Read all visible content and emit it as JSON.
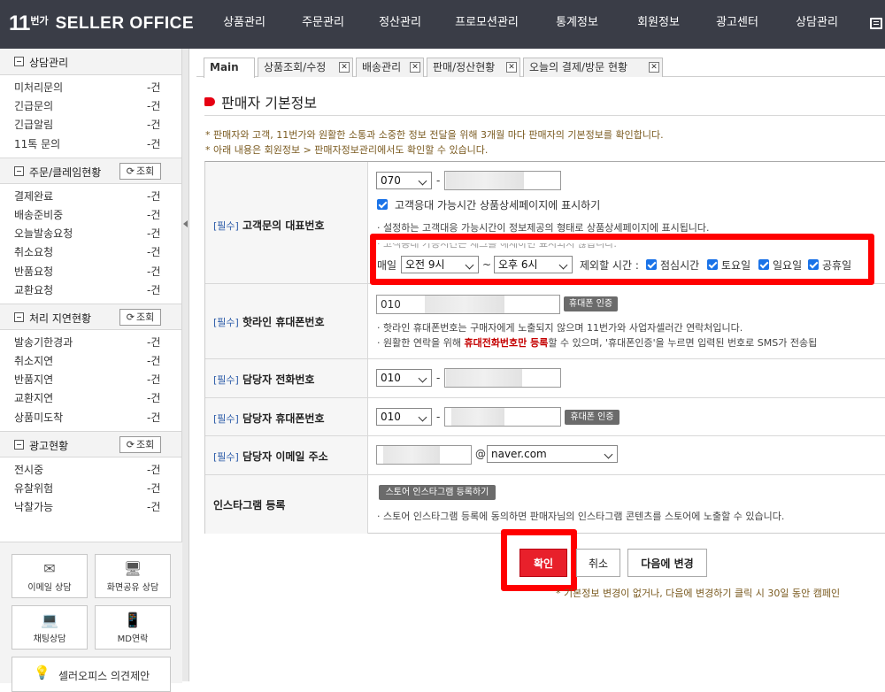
{
  "header": {
    "logo_11": "11",
    "logo_bunga": "번가",
    "logo_seller": "SELLER OFFICE",
    "nav": [
      "상품관리",
      "주문관리",
      "정산관리",
      "프로모션관리",
      "통계정보",
      "회원정보",
      "광고센터",
      "상담관리"
    ],
    "menu_icon": "menu-icon"
  },
  "sidebar": {
    "sections": [
      {
        "title": "상담관리",
        "refresh": "",
        "items": [
          {
            "label": "미처리문의",
            "count": "-건"
          },
          {
            "label": "긴급문의",
            "count": "-건"
          },
          {
            "label": "긴급알림",
            "count": "-건"
          },
          {
            "label": "11톡 문의",
            "count": "-건"
          }
        ]
      },
      {
        "title": "주문/클레임현황",
        "refresh": "조회",
        "items": [
          {
            "label": "결제완료",
            "count": "-건"
          },
          {
            "label": "배송준비중",
            "count": "-건"
          },
          {
            "label": "오늘발송요청",
            "count": "-건"
          },
          {
            "label": "취소요청",
            "count": "-건"
          },
          {
            "label": "반품요청",
            "count": "-건"
          },
          {
            "label": "교환요청",
            "count": "-건"
          }
        ]
      },
      {
        "title": "처리 지연현황",
        "refresh": "조회",
        "items": [
          {
            "label": "발송기한경과",
            "count": "-건"
          },
          {
            "label": "취소지연",
            "count": "-건"
          },
          {
            "label": "반품지연",
            "count": "-건"
          },
          {
            "label": "교환지연",
            "count": "-건"
          },
          {
            "label": "상품미도착",
            "count": "-건"
          }
        ]
      },
      {
        "title": "광고현황",
        "refresh": "조회",
        "items": [
          {
            "label": "전시중",
            "count": "-건"
          },
          {
            "label": "유찰위험",
            "count": "-건"
          },
          {
            "label": "낙찰가능",
            "count": "-건"
          }
        ]
      }
    ],
    "buttons": [
      {
        "label": "이메일 상담",
        "icon": "envelope-icon"
      },
      {
        "label": "화면공유 상담",
        "icon": "screen-share-icon"
      },
      {
        "label": "채팅상담",
        "icon": "laptop-chat-icon"
      },
      {
        "label": "MD연락",
        "icon": "phone-md-icon"
      }
    ],
    "opinion": "셀러오피스 의견제안"
  },
  "tabs": [
    {
      "label": "Main",
      "closable": false
    },
    {
      "label": "상품조회/수정",
      "closable": true
    },
    {
      "label": "배송관리",
      "closable": true
    },
    {
      "label": "판매/정산현황",
      "closable": true
    },
    {
      "label": "오늘의 결제/방문 현황",
      "closable": true
    }
  ],
  "page": {
    "title": "판매자 기본정보",
    "notice1": "* 판매자와 고객, 11번가와 원활한 소통과 소중한 정보 전달을 위해 3개월 마다 판매자의 기본정보를 확인합니다.",
    "notice2": "* 아래 내용은 회원정보 > 판매자정보관리에서도 확인할 수 있습니다."
  },
  "form": {
    "required_tag": "[필수]",
    "rep_phone": {
      "label": "고객문의 대표번호",
      "prefix": "070",
      "show_hours_label": "고객응대 가능시간 상품상세페이지에 표시하기",
      "desc": "· 설정하는 고객대응 가능시간이 정보제공의 형태로 상품상세페이지에 표시됩니다.",
      "obscured": "· 고객응대 가능시간은 체크를 해제하면 표시되지 않습니다.",
      "daily": "매일",
      "start": "오전 9시",
      "end": "오후 6시",
      "exclude_label": "제외할 시간 :",
      "excludes": [
        "점심시간",
        "토요일",
        "일요일",
        "공휴일"
      ]
    },
    "hotline": {
      "label": "핫라인 휴대폰번호",
      "prefix": "010",
      "verify": "휴대폰 인증",
      "desc1": "· 핫라인 휴대폰번호는 구매자에게 노출되지 않으며 11번가와 사업자셀러간 연락처입니다.",
      "desc2_pre": "· 원활한 연락을 위해 ",
      "desc2_hl": "휴대전화번호만 등록",
      "desc2_post": "할 수 있으며, '휴대폰인증'을 누르면 입력된 번호로 SMS가 전송됩"
    },
    "manager_phone": {
      "label": "담당자 전화번호",
      "prefix": "010"
    },
    "manager_mobile": {
      "label": "담당자 휴대폰번호",
      "prefix": "010",
      "verify": "휴대폰 인증"
    },
    "manager_email": {
      "label": "담당자 이메일 주소",
      "at": "@",
      "domain": "naver.com"
    },
    "instagram": {
      "label": "인스타그램 등록",
      "button": "스토어 인스타그램 등록하기",
      "desc": "· 스토어 인스타그램 등록에 동의하면 판매자님의 인스타그램 콘텐츠를 스토어에 노출할 수 있습니다."
    }
  },
  "actions": {
    "confirm": "확인",
    "cancel": "취소",
    "later": "다음에 변경",
    "note": "* 기본정보 변경이 없거나, 다음에 변경하기 클릭 시 30일 동안 캠페인"
  },
  "colors": {
    "accent": "#e8202b",
    "topbar": "#3a3d47",
    "highlight_box": "#ff0000",
    "checkbox": "#1a73e8"
  }
}
